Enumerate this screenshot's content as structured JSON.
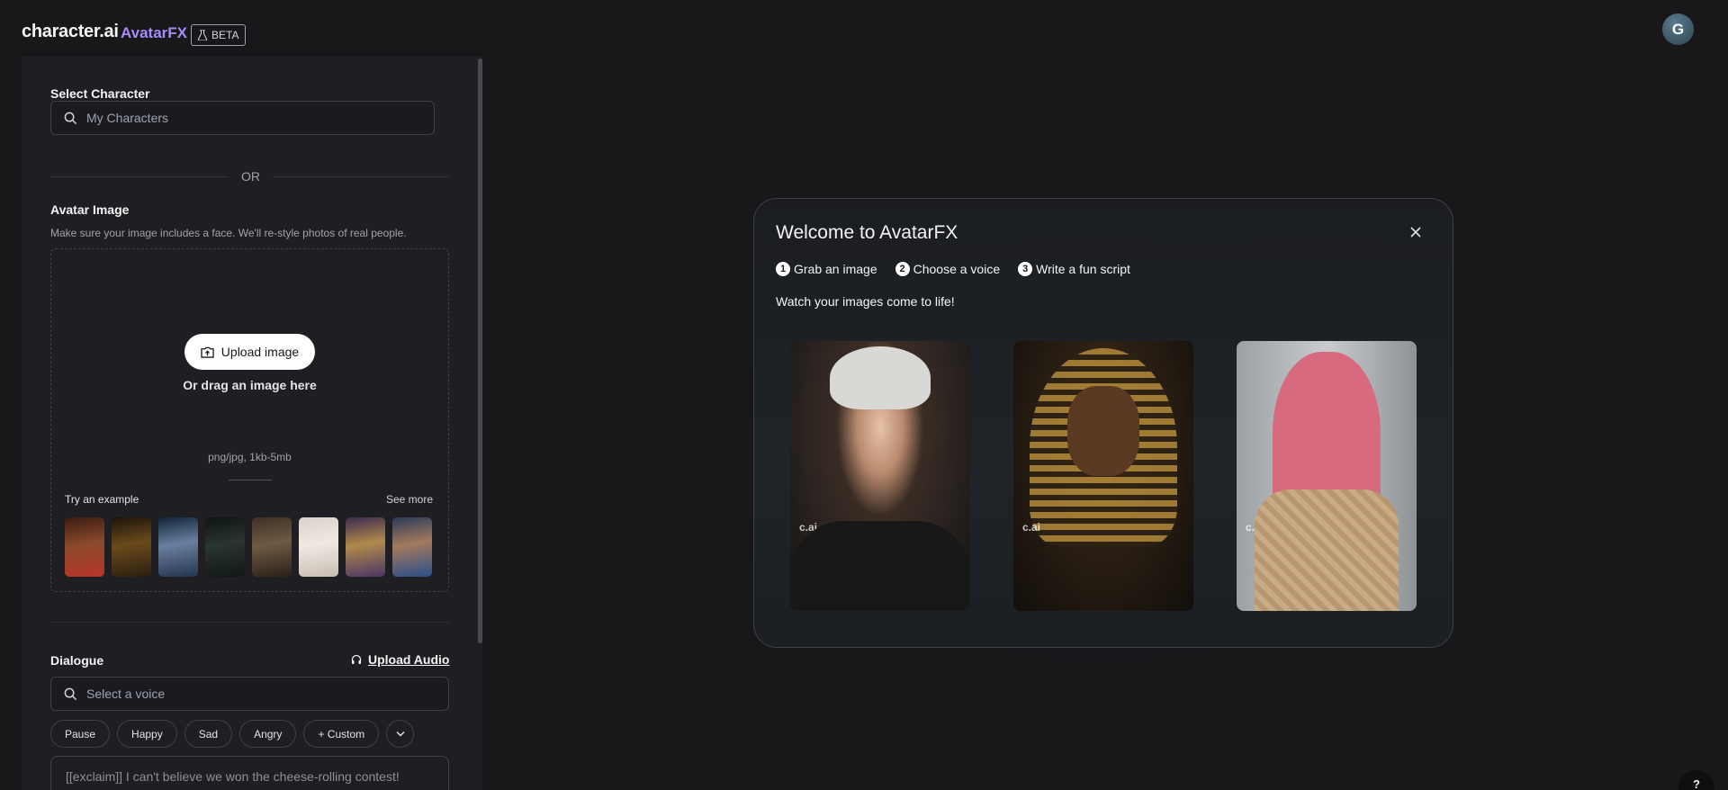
{
  "header": {
    "logo": "character.ai",
    "product": "AvatarFX",
    "badge": "BETA",
    "user_initial": "G"
  },
  "sidebar": {
    "select_character": {
      "label": "Select Character",
      "placeholder": "My Characters"
    },
    "or_text": "OR",
    "avatar_image": {
      "label": "Avatar Image",
      "hint": "Make sure your image includes a face. We'll re-style photos of real people.",
      "upload_button": "Upload image",
      "drag_text": "Or drag an image here",
      "format_hint": "png/jpg, 1kb-5mb",
      "try_example": "Try an example",
      "see_more": "See more",
      "examples_count": 8
    },
    "dialogue": {
      "label": "Dialogue",
      "upload_audio": "Upload Audio",
      "voice_placeholder": "Select a voice",
      "chips": [
        "Pause",
        "Happy",
        "Sad",
        "Angry",
        "+ Custom"
      ],
      "script_placeholder": "[[exclaim]] I can't believe we won the cheese-rolling contest!"
    }
  },
  "modal": {
    "title": "Welcome to AvatarFX",
    "steps": [
      {
        "num": "1",
        "text": "Grab an image"
      },
      {
        "num": "2",
        "text": "Choose a voice"
      },
      {
        "num": "3",
        "text": "Write a fun script"
      }
    ],
    "subtitle": "Watch your images come to life!",
    "cards": [
      {
        "watermark": "c.ai"
      },
      {
        "watermark": "c.ai"
      },
      {
        "watermark": "c.ai"
      }
    ]
  },
  "help": {
    "label": "?"
  },
  "colors": {
    "accent": "#a78bfa",
    "background": "#18181b",
    "panel": "#1f1f23"
  },
  "icons": [
    "search-icon",
    "upload-icon",
    "headphones-icon",
    "chevron-down-icon",
    "close-icon",
    "flask-icon"
  ]
}
